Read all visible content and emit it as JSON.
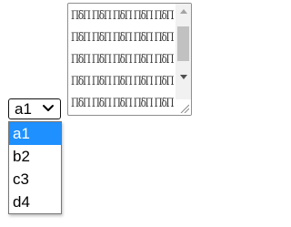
{
  "textarea": {
    "lines": [
      "ΠδΠ ΠδΠ ΠδΠ ΠδΠ ΠδΠ",
      "ΠδΠ ΠδΠ ΠδΠ ΠδΠ ΠδΠ",
      "ΠδΠ ΠδΠ ΠδΠ ΠδΠ ΠδΠ",
      "ΠδΠ ΠδΠ ΠδΠ ΠδΠ ΠδΠ",
      "ΠδΠ ΠδΠ ΠδΠ ΠδΠ ΠδΠ"
    ],
    "scroll_up_icon": "triangle-up",
    "scroll_down_icon": "triangle-down",
    "resize_icon": "resize-grip"
  },
  "select": {
    "value": "a1",
    "chevron_icon": "chevron-down",
    "options": [
      "a1",
      "b2",
      "c3",
      "d4"
    ],
    "selected_index": 0,
    "selected_color": "#1e90ff"
  }
}
